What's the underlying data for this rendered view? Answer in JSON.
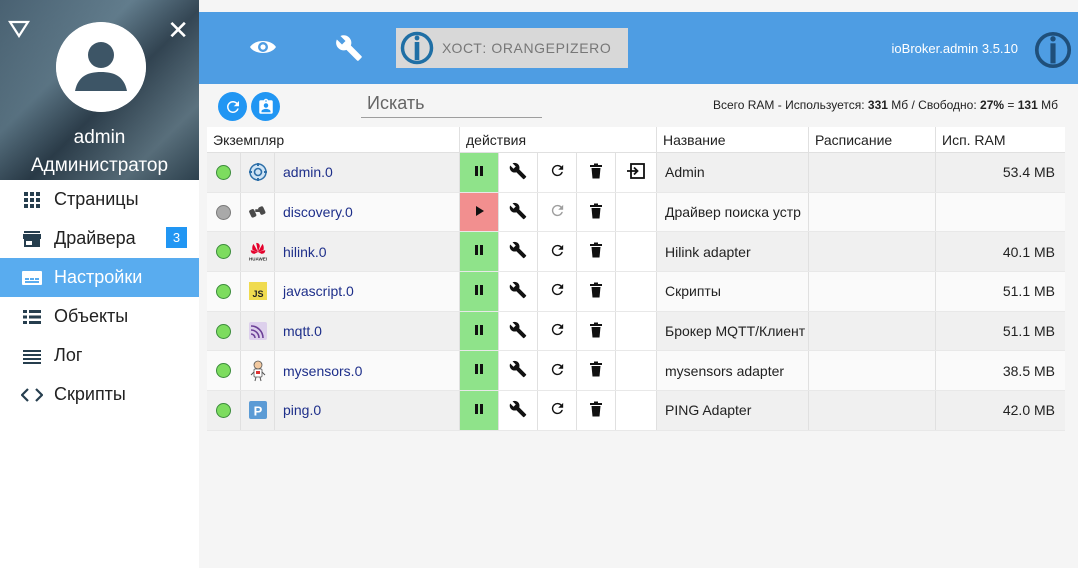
{
  "sidebar": {
    "username": "admin",
    "role": "Администратор",
    "items": [
      {
        "label": "Страницы",
        "icon": "grid-icon"
      },
      {
        "label": "Драйвера",
        "icon": "store-icon",
        "badge": "3"
      },
      {
        "label": "Настройки",
        "icon": "settings-card-icon",
        "active": true
      },
      {
        "label": "Объекты",
        "icon": "list-icon"
      },
      {
        "label": "Лог",
        "icon": "log-lines-icon"
      },
      {
        "label": "Скрипты",
        "icon": "code-icon"
      }
    ]
  },
  "appbar": {
    "host": "ХОСТ: ORANGEPIZERO",
    "version": "ioBroker.admin 3.5.10",
    "color": "#4e9de3"
  },
  "toolbar": {
    "search_placeholder": "Искать",
    "ram": {
      "prefix": "Всего RAM - Используется:",
      "used": "331",
      "mid": "Мб / Свободно:",
      "free_pct": "27%",
      "eq": "=",
      "free": "131",
      "unit": "Мб"
    }
  },
  "table": {
    "headers": {
      "instance": "Экземпляр",
      "actions": "действия",
      "title": "Название",
      "schedule": "Расписание",
      "ram": "Исп. RAM"
    },
    "rows": [
      {
        "name": "admin.0",
        "title": "Admin",
        "ram": "53.4 MB",
        "status": "green",
        "icon": "admin-gear-icon",
        "running": true,
        "link": true
      },
      {
        "name": "discovery.0",
        "title": "Драйвер поиска устр",
        "ram": "",
        "status": "grey",
        "icon": "discovery-binoculars-icon",
        "running": false,
        "link": false
      },
      {
        "name": "hilink.0",
        "title": "Hilink adapter",
        "ram": "40.1 MB",
        "status": "green",
        "icon": "huawei-logo-icon",
        "icon_text": "HUAWEI",
        "running": true,
        "link": false
      },
      {
        "name": "javascript.0",
        "title": "Скрипты",
        "ram": "51.1 MB",
        "status": "green",
        "icon": "javascript-icon",
        "icon_text": "JS",
        "running": true,
        "link": false
      },
      {
        "name": "mqtt.0",
        "title": "Брокер MQTT/Клиент",
        "ram": "51.1 MB",
        "status": "green",
        "icon": "mqtt-icon",
        "running": true,
        "link": false
      },
      {
        "name": "mysensors.0",
        "title": "mysensors adapter",
        "ram": "38.5 MB",
        "status": "green",
        "icon": "mysensors-icon",
        "running": true,
        "link": false
      },
      {
        "name": "ping.0",
        "title": "PING Adapter",
        "ram": "42.0 MB",
        "status": "green",
        "icon": "ping-icon",
        "icon_text": "P",
        "running": true,
        "link": false
      }
    ]
  }
}
